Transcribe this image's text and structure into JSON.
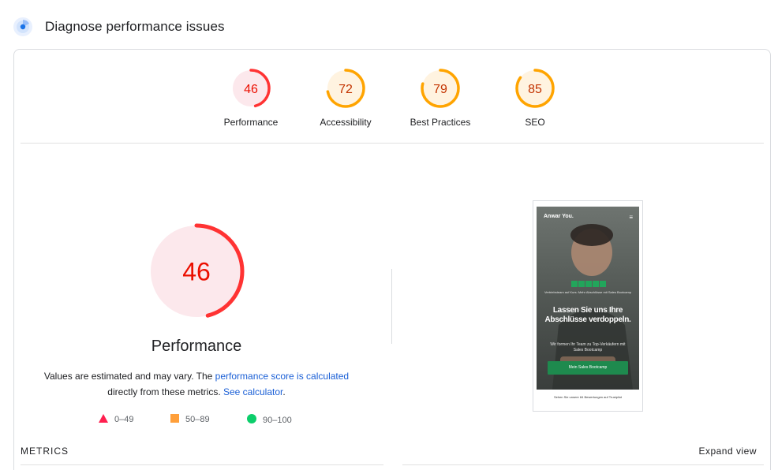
{
  "header": {
    "title": "Diagnose performance issues",
    "icon": "lighthouse-icon"
  },
  "colors": {
    "fail": "#ff3333",
    "fail_bg": "#fce8ec",
    "average": "#ffa400",
    "average_bg": "#fff3e0",
    "pass": "#0cce6b",
    "link": "#1a5fd6"
  },
  "gauges": [
    {
      "score": "46",
      "label": "Performance",
      "value": 46
    },
    {
      "score": "72",
      "label": "Accessibility",
      "value": 72
    },
    {
      "score": "79",
      "label": "Best Practices",
      "value": 79
    },
    {
      "score": "85",
      "label": "SEO",
      "value": 85
    }
  ],
  "main": {
    "score": "46",
    "value": 46,
    "title": "Performance",
    "note_prefix": "Values are estimated and may vary. The ",
    "note_link": "performance score is calculated",
    "note_middle": "directly from these metrics. ",
    "note_link2": "See calculator",
    "note_suffix": "."
  },
  "legend": [
    {
      "range": "0–49",
      "shape": "triangle"
    },
    {
      "range": "50–89",
      "shape": "square"
    },
    {
      "range": "90–100",
      "shape": "circle"
    }
  ],
  "screenshot": {
    "logo": "Anwar You.",
    "menu": "≡",
    "small_text": "Vertriebsteam auf Kurs: Mehr Abschlüsse mit Sales Bootcamp",
    "headline": "Lassen Sie uns Ihre Abschlüsse verdoppeln.",
    "subtext": "Wir formen Ihr Team zu Top-Verkäufern mit Sales Bootcamp",
    "cta": "Mein Sales Bootcamp",
    "footer": "Sehen Sie unsere 84 Bewertungen auf Trustpilot"
  },
  "metrics": {
    "label": "METRICS",
    "expand": "Expand view"
  }
}
